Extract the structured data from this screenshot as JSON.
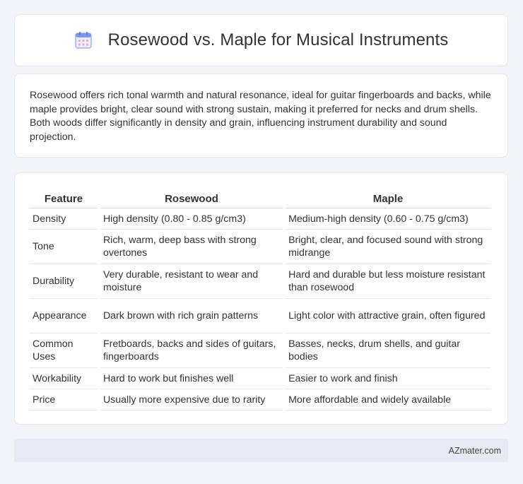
{
  "header": {
    "title": "Rosewood vs. Maple for Musical Instruments",
    "icon": "calendar-icon",
    "icon_color": "#6f8ff0"
  },
  "summary": {
    "text": "Rosewood offers rich tonal warmth and natural resonance, ideal for guitar fingerboards and backs, while maple provides bright, clear sound with strong sustain, making it preferred for necks and drum shells. Both woods differ significantly in density and grain, influencing instrument durability and sound projection."
  },
  "table": {
    "headers": [
      "Feature",
      "Rosewood",
      "Maple"
    ],
    "rows": [
      [
        "Density",
        "High density (0.80 - 0.85 g/cm3)",
        "Medium-high density (0.60 - 0.75 g/cm3)"
      ],
      [
        "Tone",
        "Rich, warm, deep bass with strong overtones",
        "Bright, clear, and focused sound with strong midrange"
      ],
      [
        "Durability",
        "Very durable, resistant to wear and moisture",
        "Hard and durable but less moisture resistant than rosewood"
      ],
      [
        "Appearance",
        "Dark brown with rich grain patterns",
        "Light color with attractive grain, often figured"
      ],
      [
        "Common Uses",
        "Fretboards, backs and sides of guitars, fingerboards",
        "Basses, necks, drum shells, and guitar bodies"
      ],
      [
        "Workability",
        "Hard to work but finishes well",
        "Easier to work and finish"
      ],
      [
        "Price",
        "Usually more expensive due to rarity",
        "More affordable and widely available"
      ]
    ]
  },
  "footer": {
    "text": "AZmater.com"
  }
}
